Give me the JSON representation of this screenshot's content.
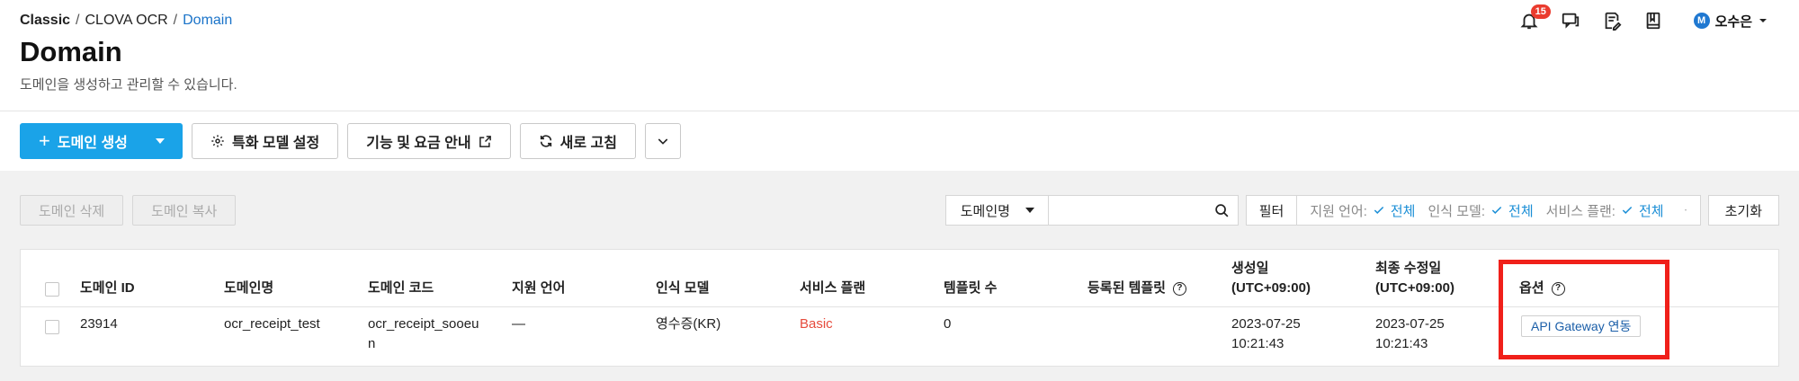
{
  "breadcrumb": {
    "root": "Classic",
    "section": "CLOVA OCR",
    "current": "Domain",
    "sep": "/"
  },
  "page": {
    "title": "Domain",
    "subtitle": "도메인을 생성하고 관리할 수 있습니다."
  },
  "header": {
    "notification_count": "15",
    "user_initial": "M",
    "user_name": "오수은"
  },
  "toolbar": {
    "create_domain": "도메인 생성",
    "special_model": "특화 모델 설정",
    "pricing": "기능 및 요금 안내",
    "refresh": "새로 고침"
  },
  "actions": {
    "delete": "도메인 삭제",
    "copy": "도메인 복사"
  },
  "search": {
    "field_selected": "도메인명",
    "placeholder": ""
  },
  "filters": {
    "label": "필터",
    "language_label": "지원 언어:",
    "language_value": "전체",
    "model_label": "인식 모델:",
    "model_value": "전체",
    "plan_label": "서비스 플랜:",
    "plan_value": "전체",
    "reset": "초기화"
  },
  "table": {
    "columns": {
      "id": "도메인 ID",
      "name": "도메인명",
      "code": "도메인 코드",
      "language": "지원 언어",
      "model": "인식 모델",
      "plan": "서비스 플랜",
      "templates": "템플릿 수",
      "registered_templates": "등록된 템플릿",
      "created_1": "생성일",
      "created_2": "(UTC+09:00)",
      "modified_1": "최종 수정일",
      "modified_2": "(UTC+09:00)",
      "options": "옵션"
    },
    "rows": [
      {
        "id": "23914",
        "name": "ocr_receipt_test",
        "code_1": "ocr_receipt_sooeu",
        "code_2": "n",
        "language": "—",
        "model": "영수증(KR)",
        "plan": "Basic",
        "templates": "0",
        "registered_templates": "",
        "created_date": "2023-07-25",
        "created_time": "10:21:43",
        "modified_date": "2023-07-25",
        "modified_time": "10:21:43",
        "option_button": "API Gateway 연동"
      }
    ]
  },
  "colors": {
    "primary": "#1aa3e8",
    "link": "#1a8ed6",
    "basic_plan": "#e64b3c",
    "highlight": "#f0201a",
    "badge": "#ea3b2e"
  }
}
